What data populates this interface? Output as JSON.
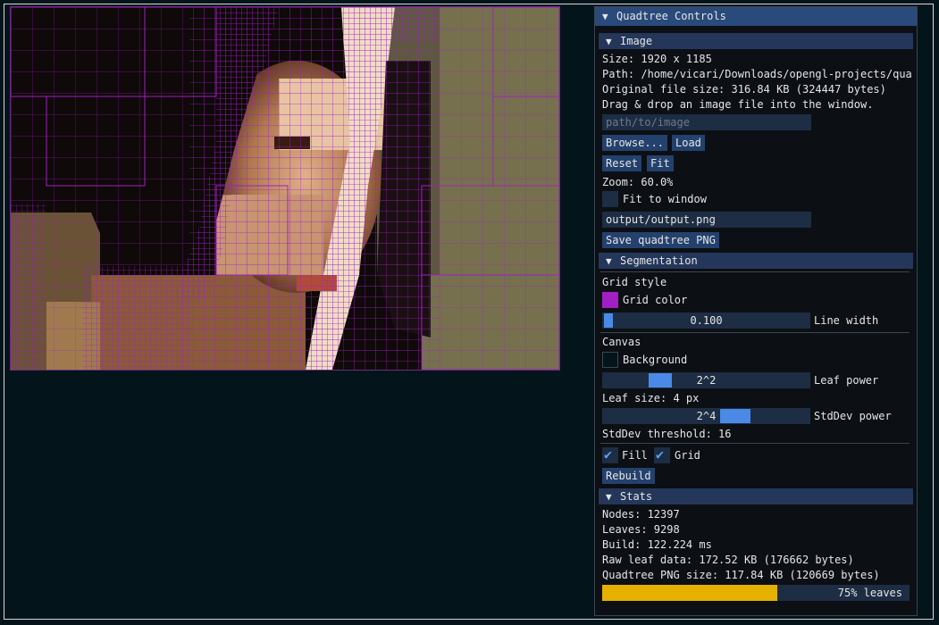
{
  "panel": {
    "title": "Quadtree Controls",
    "collapse_glyph": "▼"
  },
  "image_section": {
    "header": "Image",
    "size_text": "Size: 1920 x 1185",
    "path_text": "Path: /home/vicari/Downloads/opengl-projects/quad-",
    "file_size_text": "Original file size: 316.84 KB (324447 bytes)",
    "drag_hint": "Drag & drop an image file into the window.",
    "path_input": {
      "value": "",
      "placeholder": "path/to/image"
    },
    "browse_label": "Browse...",
    "load_label": "Load",
    "reset_label": "Reset",
    "fit_label": "Fit",
    "zoom_text": "Zoom: 60.0%",
    "fit_to_window_label": "Fit to window",
    "fit_to_window_checked": false,
    "output_input": {
      "value": "output/output.png",
      "placeholder": ""
    },
    "save_label": "Save quadtree PNG"
  },
  "segmentation_section": {
    "header": "Segmentation",
    "grid_style_label": "Grid style",
    "grid_color_label": "Grid color",
    "grid_color": "#a21fc4",
    "line_width_value": "0.100",
    "line_width_label": "Line width",
    "line_width_fraction": 0.0,
    "canvas_label": "Canvas",
    "background_label": "Background",
    "background_color": "#03141a",
    "leaf_power_value": "2^2",
    "leaf_power_label": "Leaf power",
    "leaf_size_text": "Leaf size: 4 px",
    "stddev_power_value": "2^4",
    "stddev_power_label": "StdDev power",
    "stddev_threshold_text": "StdDev threshold: 16",
    "fill_label": "Fill",
    "fill_checked": true,
    "grid_label": "Grid",
    "grid_checked": true,
    "rebuild_label": "Rebuild"
  },
  "stats_section": {
    "header": "Stats",
    "nodes_text": "Nodes:  12397",
    "leaves_text": "Leaves: 9298",
    "build_text": "Build:  122.224 ms",
    "raw_leaf_text": "Raw leaf data: 172.52 KB (176662 bytes)",
    "png_size_text": "Quadtree PNG size: 117.84 KB (120669 bytes)",
    "progress_label": "75% leaves",
    "progress_fraction": 0.75,
    "progress_color": "#e6b000"
  },
  "colors": {
    "accent": "#294a7a",
    "frame_bg": "#0c0f14",
    "grid_line": "#a21fc4"
  }
}
